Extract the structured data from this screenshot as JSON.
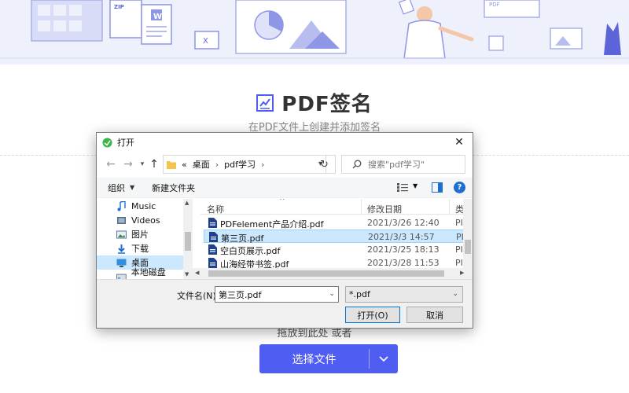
{
  "page": {
    "title": "PDF签名",
    "subtitle": "在PDF文件上创建并添加签名",
    "drop_hint": "拖放到此处 或者",
    "choose_button": "选择文件",
    "banner_labels": {
      "zip": "ZIP",
      "word": "W",
      "excel": "X",
      "pdf": "PDF"
    },
    "accent_color": "#4f5df2"
  },
  "dialog": {
    "title": "打开",
    "address": {
      "prefix": "«",
      "parts": [
        "桌面",
        "pdf学习"
      ]
    },
    "search_placeholder": "搜索\"pdf学习\"",
    "toolbar": {
      "organize": "组织",
      "new_folder": "新建文件夹",
      "help": "?"
    },
    "nav_items": [
      {
        "label": "Music",
        "icon": "music-note-icon"
      },
      {
        "label": "Videos",
        "icon": "video-icon"
      },
      {
        "label": "图片",
        "icon": "picture-icon"
      },
      {
        "label": "下载",
        "icon": "download-arrow-icon"
      },
      {
        "label": "桌面",
        "icon": "desktop-icon",
        "selected": true
      },
      {
        "label": "本地磁盘 (C:)",
        "icon": "drive-icon"
      }
    ],
    "columns": {
      "name": "名称",
      "date": "修改日期",
      "type": "类"
    },
    "files": [
      {
        "name": "PDFelement产品介绍.pdf",
        "date": "2021/3/26 12:40",
        "type": "PI"
      },
      {
        "name": "第三页.pdf",
        "date": "2021/3/3 14:57",
        "type": "PI",
        "selected": true
      },
      {
        "name": "空白页展示.pdf",
        "date": "2021/3/25 18:13",
        "type": "PI"
      },
      {
        "name": "山海经带书签.pdf",
        "date": "2021/3/28 11:53",
        "type": "PI"
      }
    ],
    "filename_label": "文件名(N):",
    "filename_value": "第三页.pdf",
    "filetype_value": "*.pdf",
    "open_button": "打开(O)",
    "cancel_button": "取消"
  }
}
